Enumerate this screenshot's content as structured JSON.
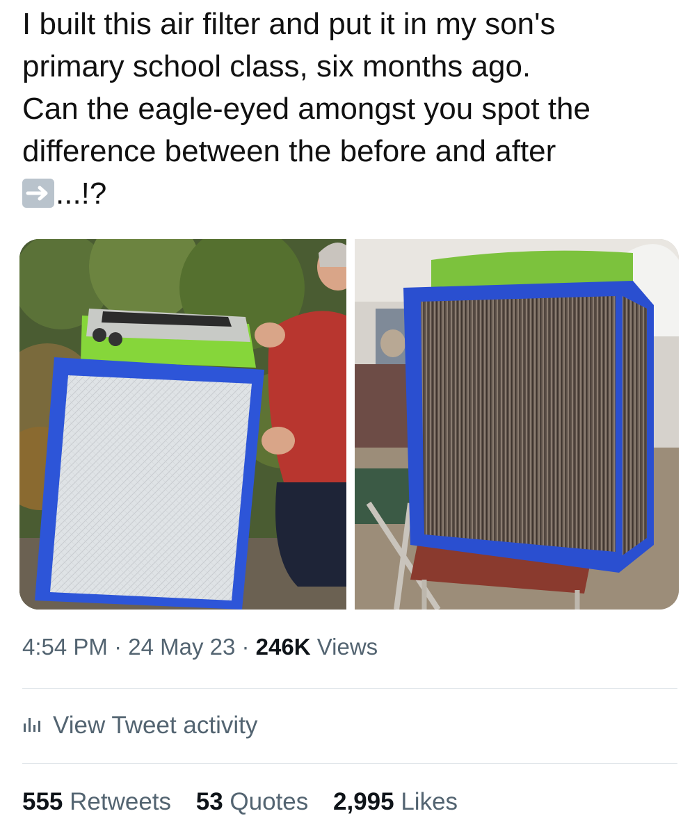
{
  "tweet": {
    "text_lines": [
      "I built this air filter and put it in my son's",
      "primary school class, six months ago.",
      "Can the eagle-eyed amongst you spot the",
      "difference between the before and after"
    ],
    "text_tail": "...!?",
    "arrow_emoji": "right-arrow-emoji"
  },
  "media": {
    "left_photo": "air-filter-before-photo",
    "right_photo": "air-filter-after-photo"
  },
  "meta": {
    "time": "4:54 PM",
    "sep1": " · ",
    "date": "24 May 23",
    "sep2": " · ",
    "views_count": "246K",
    "views_label": " Views"
  },
  "activity": {
    "icon": "bar-chart-icon",
    "label": "View Tweet activity"
  },
  "stats": {
    "retweets_count": "555",
    "retweets_label": " Retweets",
    "quotes_count": "53",
    "quotes_label": " Quotes",
    "likes_count": "2,995",
    "likes_label": " Likes"
  },
  "colors": {
    "frame_blue": "#2a55d6",
    "lid_green": "#7ed23a",
    "secondary_text": "#536471"
  }
}
